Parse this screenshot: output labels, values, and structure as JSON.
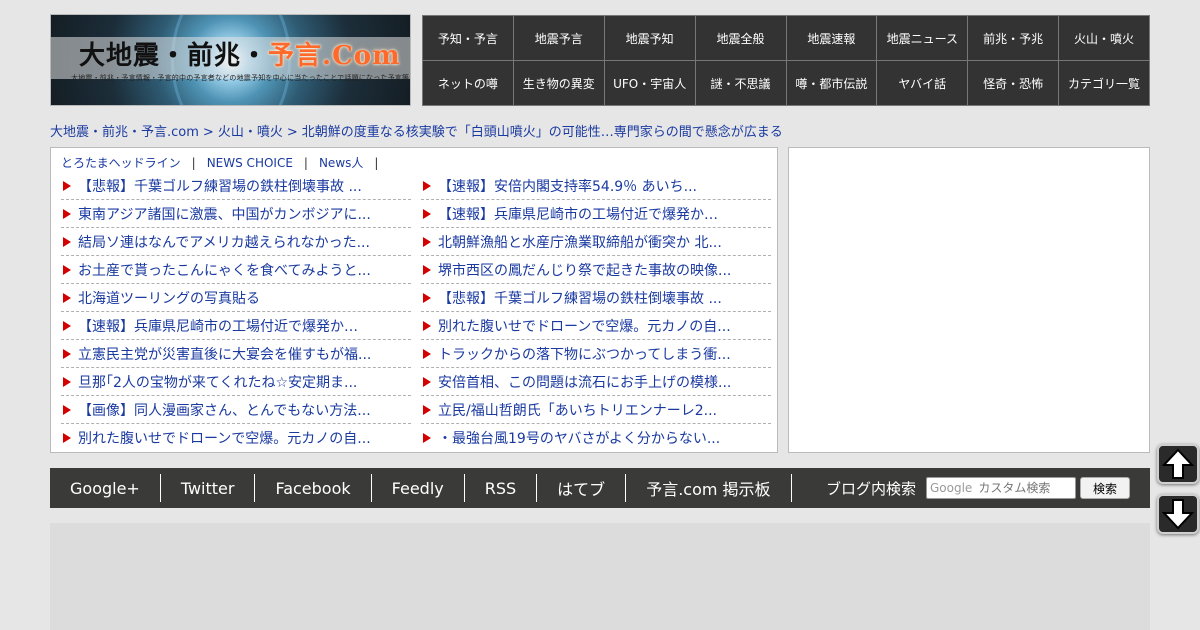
{
  "logo": {
    "title_main": "大地震・前兆・",
    "title_neon": "予言.Com",
    "subtitle": "大地震・前兆・予言情報・予言的中の予言者などの地震予知を中心に当たったことで話題になった予言等から気になる情報を紹介"
  },
  "categories": [
    "予知・予言",
    "地震予言",
    "地震予知",
    "地震全般",
    "地震速報",
    "地震ニュース",
    "前兆・予兆",
    "火山・噴火",
    "ネットの噂",
    "生き物の異変",
    "UFO・宇宙人",
    "謎・不思議",
    "噂・都市伝説",
    "ヤバイ話",
    "怪奇・恐怖",
    "カテゴリ一覧"
  ],
  "breadcrumb": {
    "home": "大地震・前兆・予言.com",
    "category": "火山・噴火",
    "current": "北朝鮮の度重なる核実験で「白頭山噴火」の可能性…専門家らの間で懸念が広まる",
    "sep": ">"
  },
  "headline_tabs": [
    "とろたまヘッドライン",
    "NEWS CHOICE",
    "News人"
  ],
  "headline_tab_sep": "|",
  "headlines_left": [
    "【悲報】千葉ゴルフ練習場の鉄柱倒壊事故 ...",
    "東南アジア諸国に激震、中国がカンボジアに...",
    "結局ソ連はなんでアメリカ越えられなかった...",
    "お土産で貰ったこんにゃくを食べてみようと...",
    "北海道ツーリングの写真貼る",
    "【速報】兵庫県尼崎市の工場付近で爆発か…",
    "立憲民主党が災害直後に大宴会を催すもが福...",
    "旦那｢2人の宝物が来てくれたね☆安定期ま...",
    "【画像】同人漫画家さん、とんでもない方法...",
    "別れた腹いせでドローンで空爆。元カノの自..."
  ],
  "headlines_right": [
    "【速報】安倍内閣支持率54.9％ あいち...",
    "【速報】兵庫県尼崎市の工場付近で爆発か…",
    "北朝鮮漁船と水産庁漁業取締船が衝突か 北...",
    "堺市西区の鳳だんじり祭で起きた事故の映像...",
    "【悲報】千葉ゴルフ練習場の鉄柱倒壊事故 ...",
    "別れた腹いせでドローンで空爆。元カノの自...",
    "トラックからの落下物にぶつかってしまう衝...",
    "安倍首相、この問題は流石にお手上げの模様...",
    "立民/福山哲朗氏「あいちトリエンナーレ2...",
    "・最強台風19号のヤバさがよく分からない..."
  ],
  "social_links": [
    "Google+",
    "Twitter",
    "Facebook",
    "Feedly",
    "RSS",
    "はてブ",
    "予言.com 掲示板"
  ],
  "search": {
    "label": "ブログ内検索",
    "brand": "Google",
    "placeholder": "カスタム検索",
    "button": "検索"
  },
  "colors": {
    "nav_bg": "#333333",
    "link": "#1a3aa0",
    "bullet": "#d40000",
    "bar_bg": "#3a3a38"
  },
  "icons": {
    "scroll_up": "arrow-up-icon",
    "scroll_down": "arrow-down-icon"
  }
}
